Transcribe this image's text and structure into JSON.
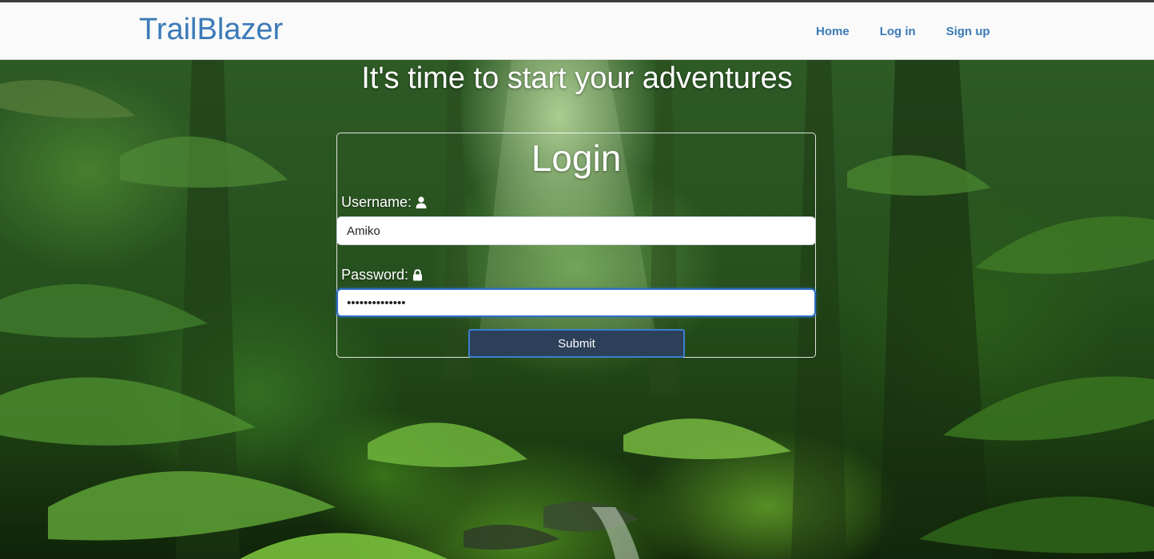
{
  "nav": {
    "brand": "TrailBlazer",
    "links": [
      {
        "label": "Home"
      },
      {
        "label": "Log in"
      },
      {
        "label": "Sign up"
      }
    ]
  },
  "hero": {
    "tagline": "It's time to start your adventures"
  },
  "login": {
    "title": "Login",
    "username_label": "Username:",
    "username_icon": "user-icon",
    "username_value": "Amiko",
    "password_label": "Password:",
    "password_icon": "lock-icon",
    "password_value": "••••••••••••••",
    "submit_label": "Submit"
  },
  "colors": {
    "brand": "#3b7ab8",
    "button_bg": "#2c4059",
    "focus_ring": "#2f6fc8"
  }
}
